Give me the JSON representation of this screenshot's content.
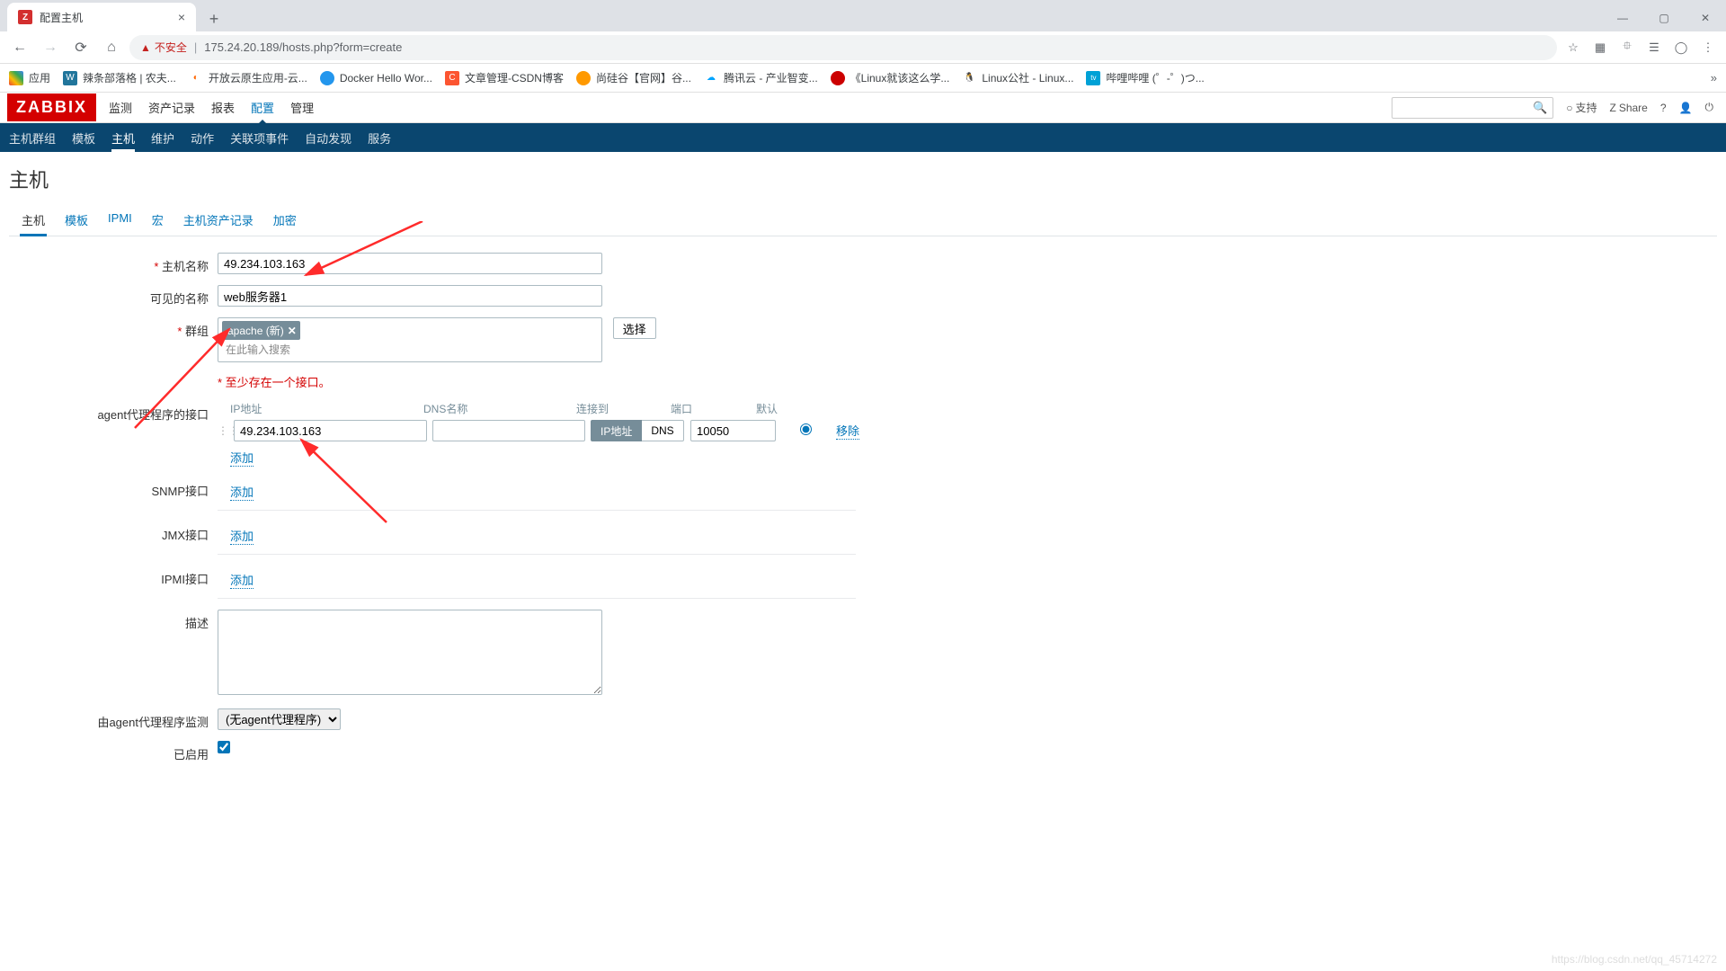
{
  "browser": {
    "tab_title": "配置主机",
    "url_insecure": "不安全",
    "url": "175.24.20.189/hosts.php?form=create",
    "bookmarks_label": "应用",
    "bookmarks": [
      "辣条部落格 | 农夫...",
      "开放云原生应用-云...",
      "Docker Hello Wor...",
      "文章管理-CSDN博客",
      "尚硅谷【官网】谷...",
      "腾讯云 - 产业智变...",
      "《Linux就该这么学...",
      "Linux公社 - Linux...",
      "哔哩哔哩 (゜-゜)つ..."
    ]
  },
  "zabbix": {
    "logo": "ZABBIX",
    "menu": [
      "监测",
      "资产记录",
      "报表",
      "配置",
      "管理"
    ],
    "menu_active": "配置",
    "support": "支持",
    "share": "Share",
    "subnav": [
      "主机群组",
      "模板",
      "主机",
      "维护",
      "动作",
      "关联项事件",
      "自动发现",
      "服务"
    ],
    "subnav_active": "主机"
  },
  "page": {
    "title": "主机",
    "tabs": [
      "主机",
      "模板",
      "IPMI",
      "宏",
      "主机资产记录",
      "加密"
    ],
    "tab_active": "主机"
  },
  "form": {
    "host_name_label": "主机名称",
    "host_name_value": "49.234.103.163",
    "visible_name_label": "可见的名称",
    "visible_name_value": "web服务器1",
    "groups_label": "群组",
    "group_tag": "apache (新)",
    "group_placeholder": "在此输入搜索",
    "select_btn": "选择",
    "iface_hint": "至少存在一个接口。",
    "agent_iface_label": "agent代理程序的接口",
    "headers": {
      "ip": "IP地址",
      "dns": "DNS名称",
      "conn": "连接到",
      "port": "端口",
      "def": "默认"
    },
    "iface": {
      "ip": "49.234.103.163",
      "dns": "",
      "conn_ip": "IP地址",
      "conn_dns": "DNS",
      "port": "10050",
      "remove": "移除"
    },
    "add": "添加",
    "snmp_label": "SNMP接口",
    "jmx_label": "JMX接口",
    "ipmi_label": "IPMI接口",
    "desc_label": "描述",
    "proxy_label": "由agent代理程序监测",
    "proxy_value": "(无agent代理程序)",
    "enabled_label": "已启用"
  },
  "watermark": "https://blog.csdn.net/qq_45714272"
}
